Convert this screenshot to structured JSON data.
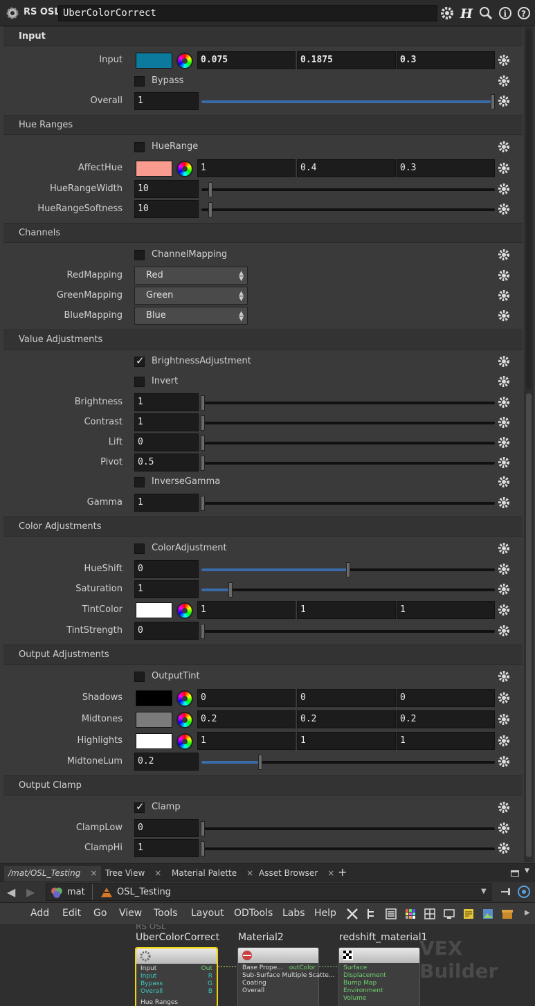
{
  "header": {
    "node_type": "RS OSL",
    "node_name": "UberColorCorrect",
    "icons": [
      "gear-icon",
      "help-h-icon",
      "search-icon",
      "info-icon",
      "question-icon"
    ]
  },
  "sections": {
    "input": {
      "title": "Input",
      "input_label": "Input",
      "input_color": "#0b7a9c",
      "input_values": [
        "0.075",
        "0.1875",
        "0.3"
      ],
      "bypass_label": "Bypass",
      "bypass_checked": false,
      "overall_label": "Overall",
      "overall_value": "1",
      "overall_fraction": 1.0
    },
    "hue_ranges": {
      "title": "Hue Ranges",
      "huerange_label": "HueRange",
      "huerange_checked": false,
      "affecthue_label": "AffectHue",
      "affecthue_color": "#f99c8f",
      "affecthue_values": [
        "1",
        "0.4",
        "0.3"
      ],
      "width_label": "HueRangeWidth",
      "width_value": "10",
      "softness_label": "HueRangeSoftness",
      "softness_value": "10"
    },
    "channels": {
      "title": "Channels",
      "mapping_label": "ChannelMapping",
      "mapping_checked": false,
      "red_label": "RedMapping",
      "red_value": "Red",
      "green_label": "GreenMapping",
      "green_value": "Green",
      "blue_label": "BlueMapping",
      "blue_value": "Blue"
    },
    "value_adjustments": {
      "title": "Value Adjustments",
      "brightness_adj_label": "BrightnessAdjustment",
      "brightness_adj_checked": true,
      "invert_label": "Invert",
      "invert_checked": false,
      "brightness_label": "Brightness",
      "brightness_value": "1",
      "contrast_label": "Contrast",
      "contrast_value": "1",
      "lift_label": "Lift",
      "lift_value": "0",
      "pivot_label": "Pivot",
      "pivot_value": "0.5",
      "inverse_gamma_label": "InverseGamma",
      "inverse_gamma_checked": false,
      "gamma_label": "Gamma",
      "gamma_value": "1"
    },
    "color_adjustments": {
      "title": "Color Adjustments",
      "color_adj_label": "ColorAdjustment",
      "color_adj_checked": false,
      "hueshift_label": "HueShift",
      "hueshift_value": "0",
      "hueshift_fraction": 0.5,
      "saturation_label": "Saturation",
      "saturation_value": "1",
      "saturation_fraction": 0.1,
      "tint_label": "TintColor",
      "tint_color": "#ffffff",
      "tint_values": [
        "1",
        "1",
        "1"
      ],
      "tint_strength_label": "TintStrength",
      "tint_strength_value": "0"
    },
    "output_adjustments": {
      "title": "Output Adjustments",
      "output_tint_label": "OutputTint",
      "output_tint_checked": false,
      "shadows_label": "Shadows",
      "shadows_color": "#000000",
      "shadows_values": [
        "0",
        "0",
        "0"
      ],
      "midtones_label": "Midtones",
      "midtones_color": "#7b7b7b",
      "midtones_values": [
        "0.2",
        "0.2",
        "0.2"
      ],
      "highlights_label": "Highlights",
      "highlights_color": "#ffffff",
      "highlights_values": [
        "1",
        "1",
        "1"
      ],
      "midtone_lum_label": "MidtoneLum",
      "midtone_lum_value": "0.2",
      "midtone_lum_fraction": 0.2
    },
    "output_clamp": {
      "title": "Output Clamp",
      "clamp_label": "Clamp",
      "clamp_checked": true,
      "clamp_low_label": "ClampLow",
      "clamp_low_value": "0",
      "clamp_hi_label": "ClampHi",
      "clamp_hi_value": "1"
    }
  },
  "tabs": [
    {
      "label": "/mat/OSL_Testing",
      "active": true
    },
    {
      "label": "Tree View",
      "active": false
    },
    {
      "label": "Material Palette",
      "active": false
    },
    {
      "label": "Asset Browser",
      "active": false
    }
  ],
  "path": {
    "root": "mat",
    "node": "OSL_Testing"
  },
  "menu": [
    "Add",
    "Edit",
    "Go",
    "View",
    "Tools",
    "Layout",
    "ODTools",
    "Labs",
    "Help"
  ],
  "network": {
    "watermark": "VEX Builder",
    "nodes": {
      "uber": {
        "type": "RS OSL",
        "title": "UberColorCorrect",
        "inputs": [
          "Input",
          "Input",
          "Bypass",
          "Overall",
          "Hue Ranges"
        ],
        "outputs": [
          "Out",
          "R",
          "G",
          "B"
        ]
      },
      "material2": {
        "title": "Material2",
        "inputs": [
          "Base Prope...",
          "Sub-Surface Multiple Scatte...",
          "Coating",
          "Overall"
        ],
        "output": "outColor"
      },
      "redshift": {
        "title": "redshift_material1",
        "inputs": [
          "Surface",
          "Displacement",
          "Bump Map",
          "Environment",
          "Volume"
        ]
      }
    }
  }
}
